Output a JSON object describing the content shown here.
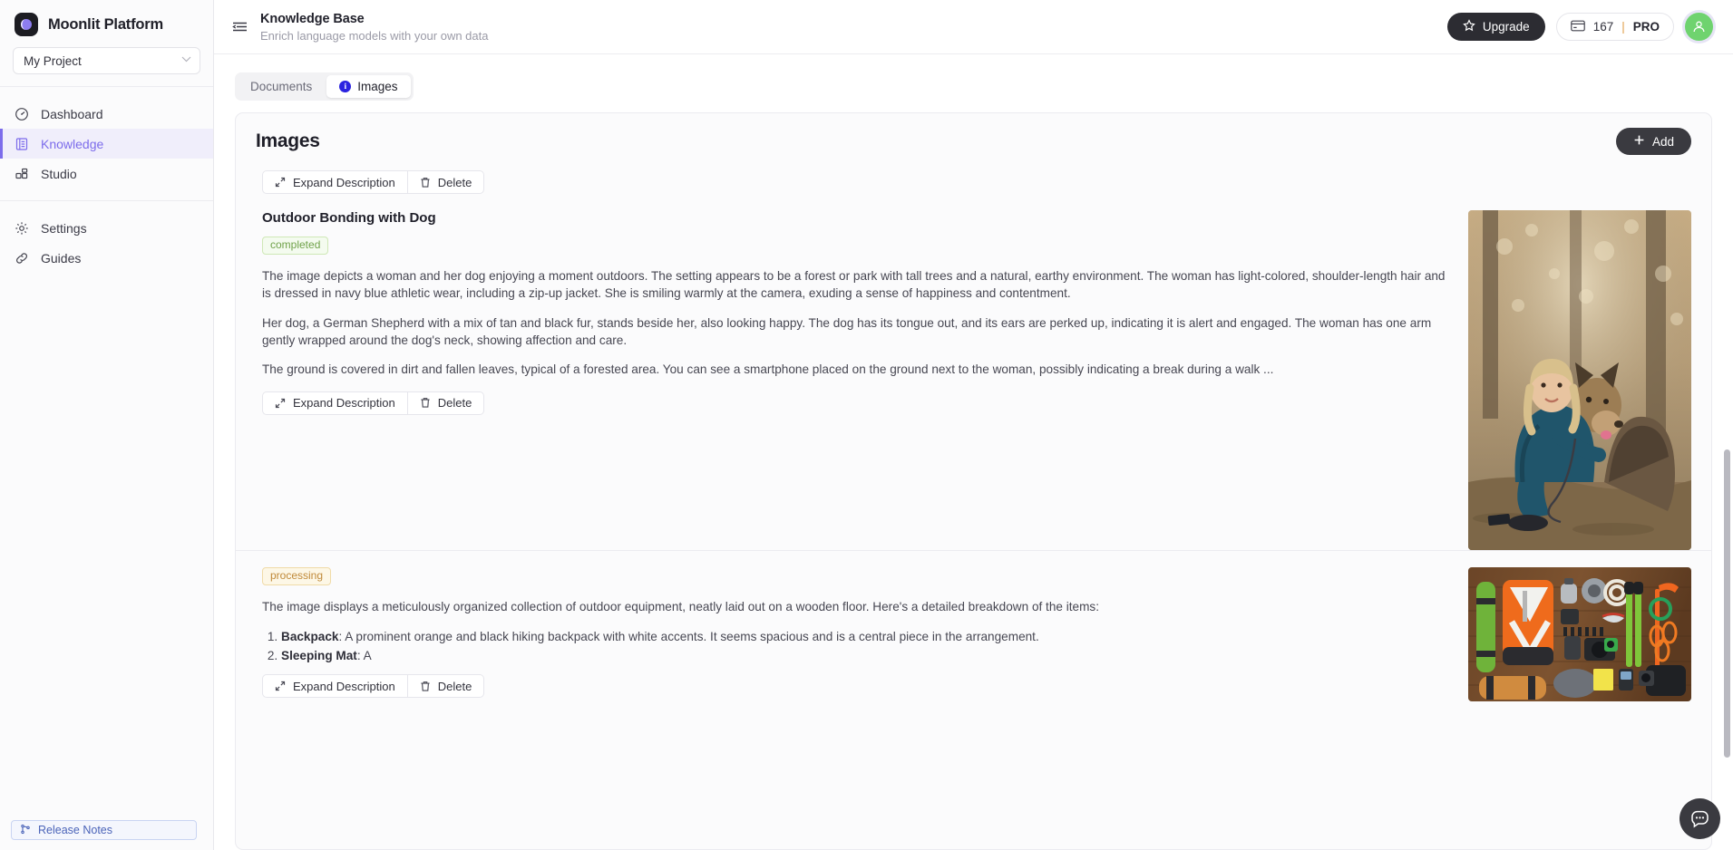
{
  "sidebar": {
    "brand": {
      "name": "Moonlit Platform",
      "logo_icon": "moon-logo-icon"
    },
    "project_selector": {
      "value": "My Project",
      "icon": "chevron-down-icon"
    },
    "groups": [
      {
        "items": [
          {
            "label": "Dashboard",
            "icon": "gauge-icon",
            "active": false
          },
          {
            "label": "Knowledge",
            "icon": "book-icon",
            "active": true
          },
          {
            "label": "Studio",
            "icon": "blocks-icon",
            "active": false
          }
        ]
      },
      {
        "items": [
          {
            "label": "Settings",
            "icon": "gear-icon",
            "active": false
          },
          {
            "label": "Guides",
            "icon": "link-icon",
            "active": false
          }
        ]
      }
    ],
    "release_notes": {
      "label": "Release Notes",
      "icon": "git-branch-icon"
    }
  },
  "topbar": {
    "menu_icon": "collapse-sidebar-icon",
    "title": "Knowledge Base",
    "subtitle": "Enrich language models with your own data",
    "upgrade_label": "Upgrade",
    "upgrade_icon": "star-icon",
    "credits": {
      "icon": "card-icon",
      "amount": "167",
      "separator": "|",
      "plan": "PRO"
    },
    "avatar_icon": "user-avatar-icon"
  },
  "tabs": [
    {
      "label": "Documents",
      "active": false
    },
    {
      "label": "Images",
      "active": true,
      "badge": "i"
    }
  ],
  "card": {
    "title": "Images",
    "add_label": "Add",
    "add_icon": "plus-icon",
    "toolbar": {
      "expand_label": "Expand Description",
      "expand_icon": "expand-icon",
      "delete_label": "Delete",
      "delete_icon": "trash-icon"
    }
  },
  "items": [
    {
      "title": "Outdoor Bonding with Dog",
      "status": "completed",
      "status_kind": "completed",
      "paragraphs": [
        "The image depicts a woman and her dog enjoying a moment outdoors. The setting appears to be a forest or park with tall trees and a natural, earthy environment. The woman has light-colored, shoulder-length hair and is dressed in navy blue athletic wear, including a zip-up jacket. She is smiling warmly at the camera, exuding a sense of happiness and contentment.",
        "Her dog, a German Shepherd with a mix of tan and black fur, stands beside her, also looking happy. The dog has its tongue out, and its ears are perked up, indicating it is alert and engaged. The woman has one arm gently wrapped around the dog's neck, showing affection and care.",
        "The ground is covered in dirt and fallen leaves, typical of a forested area. You can see a smartphone placed on the ground next to the woman, possibly indicating a break during a walk ..."
      ],
      "list": [],
      "image_alt": "Woman kneeling in a forest hugging a German Shepherd dog",
      "toolbar": {
        "expand_label": "Expand Description",
        "delete_label": "Delete"
      }
    },
    {
      "title": "",
      "status": "processing",
      "status_kind": "processing",
      "paragraphs": [
        "The image displays a meticulously organized collection of outdoor equipment, neatly laid out on a wooden floor. Here's a detailed breakdown of the items:"
      ],
      "list": [
        {
          "term": "Backpack",
          "text": ": A prominent orange and black hiking backpack with white accents. It seems spacious and is a central piece in the arrangement."
        },
        {
          "term": "Sleeping Mat",
          "text": ": A"
        }
      ],
      "image_alt": "Flat lay of outdoor camping gear on a wooden floor",
      "toolbar": {
        "expand_label": "Expand Description",
        "delete_label": "Delete"
      }
    }
  ],
  "chat": {
    "icon": "chat-bubble-icon"
  },
  "colors": {
    "accent": "#7c6ceb",
    "badge_info": "#2b23e0",
    "status_completed": "#70a24a",
    "status_processing": "#c08a3a",
    "dark_button": "#2c2c32",
    "avatar": "#6fd36f"
  }
}
